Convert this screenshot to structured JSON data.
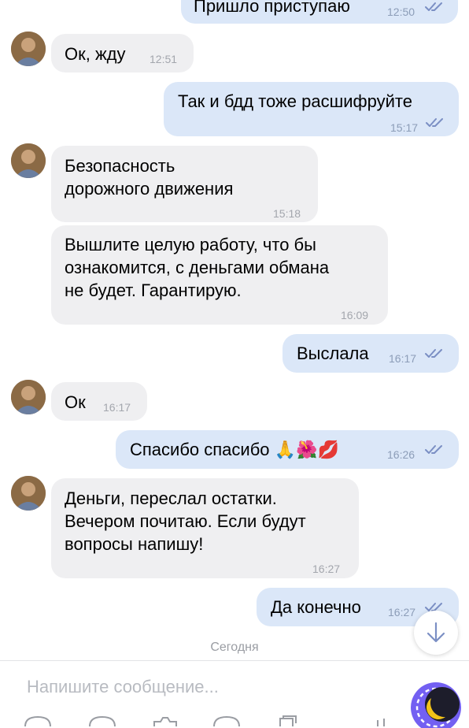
{
  "messages": [
    {
      "dir": "out",
      "text": "Пришло приступаю",
      "time": "12:50"
    },
    {
      "dir": "in",
      "text": "Ок, жду",
      "time": "12:51"
    },
    {
      "dir": "out",
      "text": "Так и бдд тоже расшифруйте",
      "time": "15:17"
    },
    {
      "dir": "in",
      "lines": [
        "Безопасность",
        "дорожного движения"
      ],
      "time": "15:18"
    },
    {
      "dir": "in",
      "lines": [
        "Вышлите целую работу, что бы",
        "ознакомится, с деньгами обмана",
        "не будет. Гарантирую."
      ],
      "time": "16:09"
    },
    {
      "dir": "out",
      "text": "Выслала",
      "time": "16:17"
    },
    {
      "dir": "in",
      "text": "Ок",
      "time": "16:17"
    },
    {
      "dir": "out",
      "text": "Спасибо спасибо 🙏🌺💋",
      "time": "16:26"
    },
    {
      "dir": "in",
      "lines": [
        "Деньги, переслал остатки.",
        "Вечером почитаю. Если будут",
        "вопросы напишу!"
      ],
      "time": "16:27"
    },
    {
      "dir": "out",
      "text": "Да конечно",
      "time": "16:27"
    }
  ],
  "date_separator": "Сегодня",
  "composer": {
    "placeholder": "Напишите сообщение..."
  },
  "colors": {
    "incoming": "#efeff1",
    "outgoing": "#dbe7f8",
    "ticks": "#7b8fc4",
    "accent": "#7360f2"
  }
}
